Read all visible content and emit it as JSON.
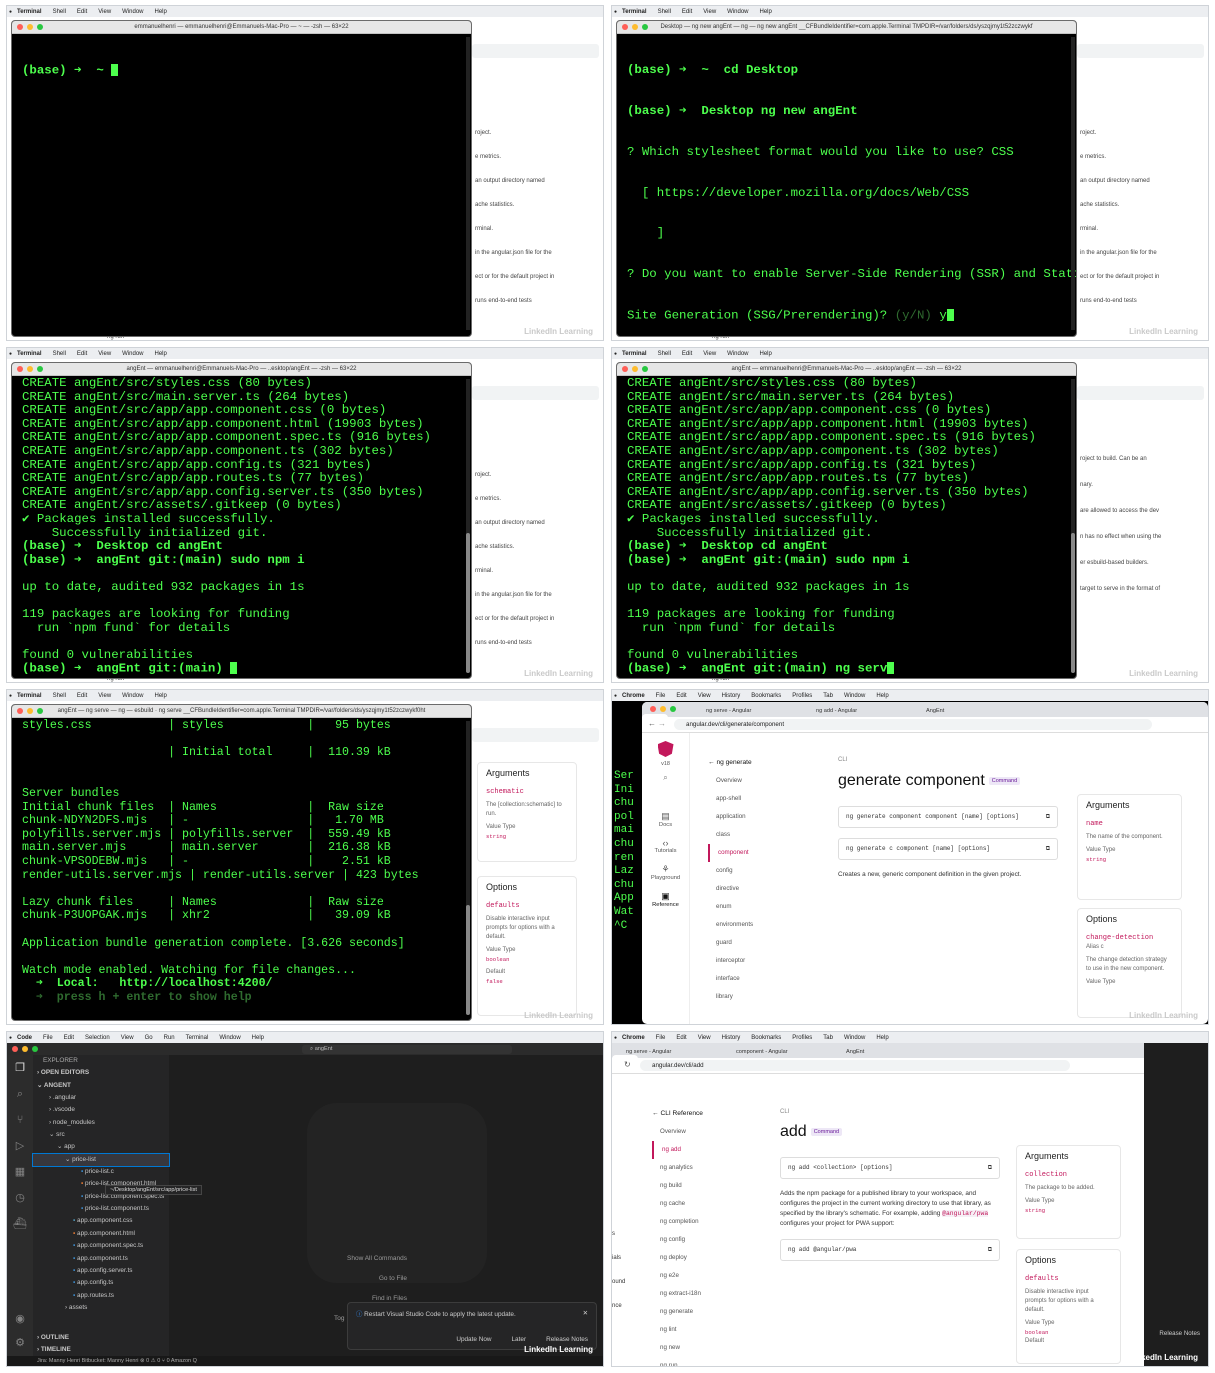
{
  "mac_menu": {
    "terminal": [
      "Terminal",
      "Shell",
      "Edit",
      "View",
      "Window",
      "Help"
    ],
    "chrome": [
      "Chrome",
      "File",
      "Edit",
      "View",
      "History",
      "Bookmarks",
      "Profiles",
      "Tab",
      "Window",
      "Help"
    ],
    "code": [
      "Code",
      "File",
      "Edit",
      "Selection",
      "View",
      "Go",
      "Run",
      "Terminal",
      "Window",
      "Help"
    ]
  },
  "bg_page": {
    "lines": [
      "roject.",
      "e metrics.",
      "an output directory named",
      "ache statistics.",
      "rminal.",
      "in the angular.json file for the",
      "ect or for the default project in",
      "runs end-to-end tests"
    ],
    "footer": "ng run",
    "lines_p4": [
      "roject to build. Can be an",
      "nary.",
      "are allowed to access the dev",
      "n has no effect when using the",
      "er esbuild-based builders.",
      "target to serve in the format of"
    ],
    "p4_labels": [
      "s",
      "get"
    ]
  },
  "watermark": "LinkedIn Learning",
  "panel1": {
    "title": "emmanuelhenri — emmanuelhenri@Emmanuels-Mac-Pro — ~ — -zsh — 63×22",
    "prompt": "(base) ➜  ~ "
  },
  "panel2": {
    "title": "Desktop — ng new angEnt — ng — ng new angEnt __CFBundleIdentifier=com.apple.Terminal TMPDIR=/var/folders/ds/yszqjmy1t52zczwykf",
    "lines": [
      "(base) ➜  ~  cd Desktop",
      "(base) ➜  Desktop ng new angEnt",
      "? Which stylesheet format would you like to use? CSS",
      "  [ https://developer.mozilla.org/docs/Web/CSS",
      "    ]",
      "? Do you want to enable Server-Side Rendering (SSR) and Static",
      "Site Generation (SSG/Prerendering)? ",
      "(y/N) ",
      "y"
    ]
  },
  "panel3": {
    "title": "angEnt — emmanuelhenri@Emmanuels-Mac-Pro — ..esktop/angEnt — -zsh — 63×22",
    "lines": [
      "CREATE angEnt/src/styles.css (80 bytes)",
      "CREATE angEnt/src/main.server.ts (264 bytes)",
      "CREATE angEnt/src/app/app.component.css (0 bytes)",
      "CREATE angEnt/src/app/app.component.html (19903 bytes)",
      "CREATE angEnt/src/app/app.component.spec.ts (916 bytes)",
      "CREATE angEnt/src/app/app.component.ts (302 bytes)",
      "CREATE angEnt/src/app/app.config.ts (321 bytes)",
      "CREATE angEnt/src/app/app.routes.ts (77 bytes)",
      "CREATE angEnt/src/app/app.config.server.ts (350 bytes)",
      "CREATE angEnt/src/assets/.gitkeep (0 bytes)",
      "✔ Packages installed successfully.",
      "    Successfully initialized git.",
      "(base) ➜  Desktop cd angEnt",
      "(base) ➜  angEnt git:(main) sudo npm i",
      "",
      "up to date, audited 932 packages in 1s",
      "",
      "119 packages are looking for funding",
      "  run `npm fund` for details",
      "",
      "found 0 vulnerabilities",
      "(base) ➜  angEnt git:(main) "
    ]
  },
  "panel4": {
    "title": "angEnt — emmanuelhenri@Emmanuels-Mac-Pro — ..esktop/angEnt — -zsh — 63×22",
    "last_line": "(base) ➜  angEnt git:(main) ng serv"
  },
  "panel5": {
    "title": "angEnt — ng serve — ng — esbuild · ng serve __CFBundleIdentifier=com.apple.Terminal TMPDIR=/var/folders/ds/yszqjmy1t52zczwykf0ht",
    "lines": [
      "styles.css           | styles            |   95 bytes",
      "",
      "                     | Initial total     |  110.39 kB",
      "",
      "",
      "Server bundles",
      "Initial chunk files  | Names             |  Raw size",
      "chunk-NDYN2DFS.mjs   | -                 |   1.70 MB",
      "polyfills.server.mjs | polyfills.server  |  559.49 kB",
      "main.server.mjs      | main.server       |  216.38 kB",
      "chunk-VPSODEBW.mjs   | -                 |    2.51 kB",
      "render-utils.server.mjs | render-utils.server | 423 bytes",
      "",
      "Lazy chunk files     | Names             |  Raw size",
      "chunk-P3UOPGAK.mjs   | xhr2              |   39.09 kB",
      "",
      "Application bundle generation complete. [3.626 seconds]",
      "",
      "Watch mode enabled. Watching for file changes...",
      "  ➜  Local:   http://localhost:4200/",
      "  ➜  press h + enter to show help"
    ],
    "right_args": "Arguments",
    "right_schematic": "schematic",
    "right_schematic_desc": "The [collection:schematic] to run.",
    "right_value_type": "Value Type",
    "right_string": "string",
    "right_options": "Options",
    "right_defaults": "defaults",
    "right_defaults_desc": "Disable interactive input prompts for options with a default.",
    "right_boolean": "boolean",
    "right_default": "Default",
    "right_false": "false"
  },
  "panel6": {
    "tabs": [
      "ng serve - Angular",
      "component - Angular",
      "ng add - Angular",
      "AngEnt"
    ],
    "url": "angular.dev/cli/generate/component",
    "version": "v18",
    "left_icons": [
      "Docs",
      "Tutorials",
      "Playground",
      "Reference"
    ],
    "back_label": "ng generate",
    "nav": [
      "Overview",
      "app-shell",
      "application",
      "class",
      "component",
      "config",
      "directive",
      "enum",
      "environments",
      "guard",
      "interceptor",
      "interface",
      "library"
    ],
    "crumb": "CLI",
    "heading": "generate component",
    "badge": "Command",
    "code1": "ng generate component component [name] [options]",
    "code2": "ng generate c component [name] [options]",
    "desc": "Creates a new, generic component definition in the given project.",
    "args_title": "Arguments",
    "arg_name": "name",
    "arg_desc": "The name of the component.",
    "value_type": "Value Type",
    "arg_type": "string",
    "opts_title": "Options",
    "opt_name": "change-detection",
    "opt_alias": "Alias c",
    "opt_desc": "The change detection strategy to use in the new component.",
    "opt_vt": "Value Type",
    "left_strip": [
      "Ser",
      "Ini",
      "chu",
      "pol",
      "mai",
      "chu",
      "ren",
      "Laz",
      "chu",
      "App",
      "Wat",
      "^C"
    ]
  },
  "panel7": {
    "search": "angEnt",
    "explorer": "EXPLORER",
    "open_editors": "OPEN EDITORS",
    "root": "ANGENT",
    "tree": [
      ".angular",
      ".vscode",
      "node_modules",
      "src",
      "app",
      "price-list",
      "price-list.c",
      "price-list.component.html",
      "price-list.component.spec.ts",
      "price-list.component.ts",
      "app.component.css",
      "app.component.html",
      "app.component.spec.ts",
      "app.component.ts",
      "app.config.server.ts",
      "app.config.ts",
      "app.routes.ts",
      "assets"
    ],
    "tooltip": "~/Desktop/angEnt/src/app/price-list",
    "outline": "OUTLINE",
    "timeline": "TIMELINE",
    "shortcuts": [
      "Show All Commands",
      "Go to File",
      "Find in Files",
      "Tog"
    ],
    "notif": "Restart Visual Studio Code to apply the latest update.",
    "notif_btns": [
      "Update Now",
      "Later",
      "Release Notes"
    ],
    "status": "Jira: Manny Henri   Bitbucket: Manny Henri   ⊗ 0 ⚠ 0   ⑂ 0   Amazon Q"
  },
  "panel8": {
    "tabs": [
      "ng serve - Angular",
      "component - Angular",
      "ng add - Angular",
      "AngEnt"
    ],
    "url": "angular.dev/cli/add",
    "back_label": "CLI Reference",
    "nav": [
      "Overview",
      "ng add",
      "ng analytics",
      "ng build",
      "ng cache",
      "ng completion",
      "ng config",
      "ng deploy",
      "ng e2e",
      "ng extract-i18n",
      "ng generate",
      "ng lint",
      "ng new",
      "ng run"
    ],
    "crumb": "CLI",
    "heading": "add",
    "badge": "Command",
    "code1": "ng add <collection> [options]",
    "desc1": "Adds the npm package for a published library to your workspace, and configures the project in the current working directory to use that library, as specified by the library's schematic. For example, adding",
    "desc_code": "@angular/pwa",
    "desc2": " configures your project for PWA support:",
    "code2": "ng add @angular/pwa",
    "args_title": "Arguments",
    "arg_name": "collection",
    "arg_desc": "The package to be added.",
    "value_type": "Value Type",
    "arg_type": "string",
    "opts_title": "Options",
    "opt_name": "defaults",
    "opt_desc": "Disable interactive input prompts for options with a default.",
    "opt_vt": "Value Type",
    "opt_type": "boolean",
    "opt_default": "Default",
    "left_strip": [
      "s",
      "ials",
      "ound",
      "nce"
    ],
    "notif_btn": "Release Notes"
  }
}
